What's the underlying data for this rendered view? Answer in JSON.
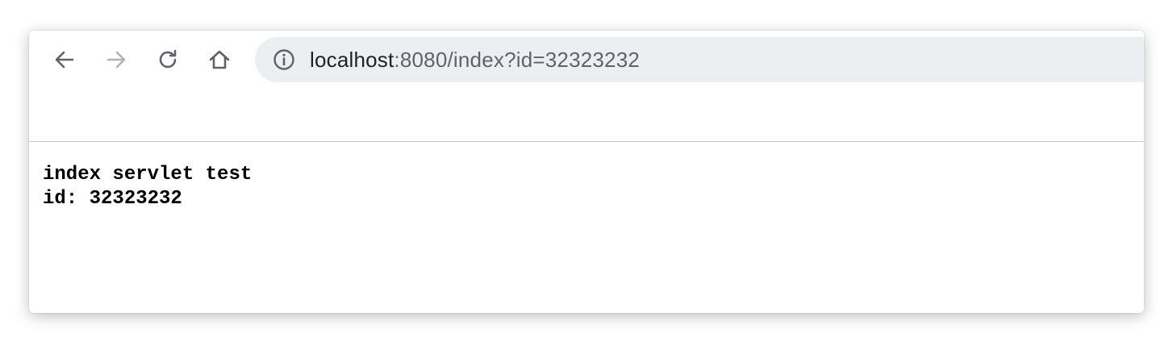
{
  "browser": {
    "nav": {
      "back_icon": "arrow-left-icon",
      "forward_icon": "arrow-right-icon",
      "reload_icon": "reload-icon",
      "home_icon": "home-icon"
    },
    "address_bar": {
      "info_icon": "info-circle-icon",
      "host": "localhost",
      "path": ":8080/index?id=32323232"
    }
  },
  "page": {
    "line1": "index servlet test",
    "line2": "id: 32323232"
  },
  "colors": {
    "omnibox_bg": "#eceff1",
    "host_text": "#202124",
    "path_text": "#5f6368",
    "icon_active": "#5f6368",
    "icon_disabled": "#b0b3b6"
  }
}
